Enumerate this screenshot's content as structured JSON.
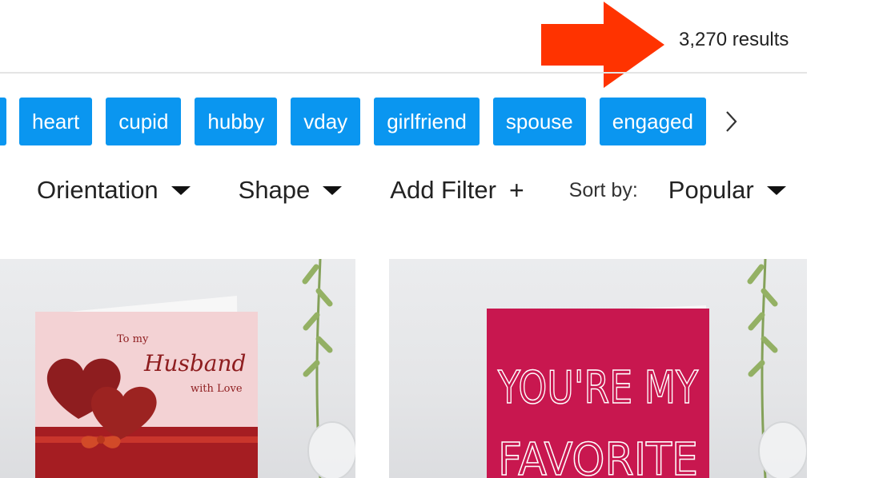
{
  "results": {
    "count_text": "3,270 results"
  },
  "tags": [
    "heart",
    "cupid",
    "hubby",
    "vday",
    "girlfriend",
    "spouse",
    "engaged"
  ],
  "filters": {
    "orientation_label": "Orientation",
    "shape_label": "Shape",
    "add_filter_label": "Add Filter",
    "add_filter_icon": "+",
    "sort_label": "Sort by:",
    "sort_value": "Popular"
  },
  "products": [
    {
      "card_text": [
        "To my",
        "Husband",
        "with Love"
      ]
    },
    {
      "card_text": [
        "YOU'RE MY",
        "FAVORITE"
      ]
    }
  ],
  "colors": {
    "accent_blue": "#0a96f0",
    "annotation_arrow": "#ff3300",
    "card1_background": "#f3d2d4",
    "card2_background": "#c8174f"
  }
}
